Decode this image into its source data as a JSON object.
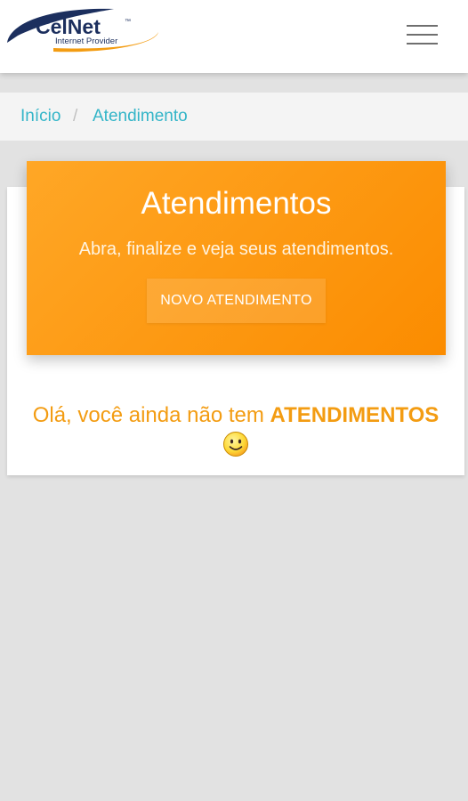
{
  "header": {
    "logo": {
      "brand": "CelNet",
      "tagline": "Internet Provider"
    },
    "menu_icon": "hamburger-menu-icon"
  },
  "breadcrumb": {
    "items": [
      {
        "label": "Início"
      },
      {
        "label": "Atendimento"
      }
    ],
    "separator": "/"
  },
  "hero": {
    "title": "Atendimentos",
    "subtitle": "Abra, finalize e veja seus atendimentos.",
    "button_label": "NOVO ATENDIMENTO"
  },
  "empty_state": {
    "message_prefix": "Olá, você ainda não tem ",
    "message_bold": "ATENDIMENTOS",
    "emoji_icon": "smiley-icon"
  },
  "colors": {
    "accent": "#fb8c00",
    "link": "#33b5c8",
    "empty_text": "#f39c12"
  }
}
